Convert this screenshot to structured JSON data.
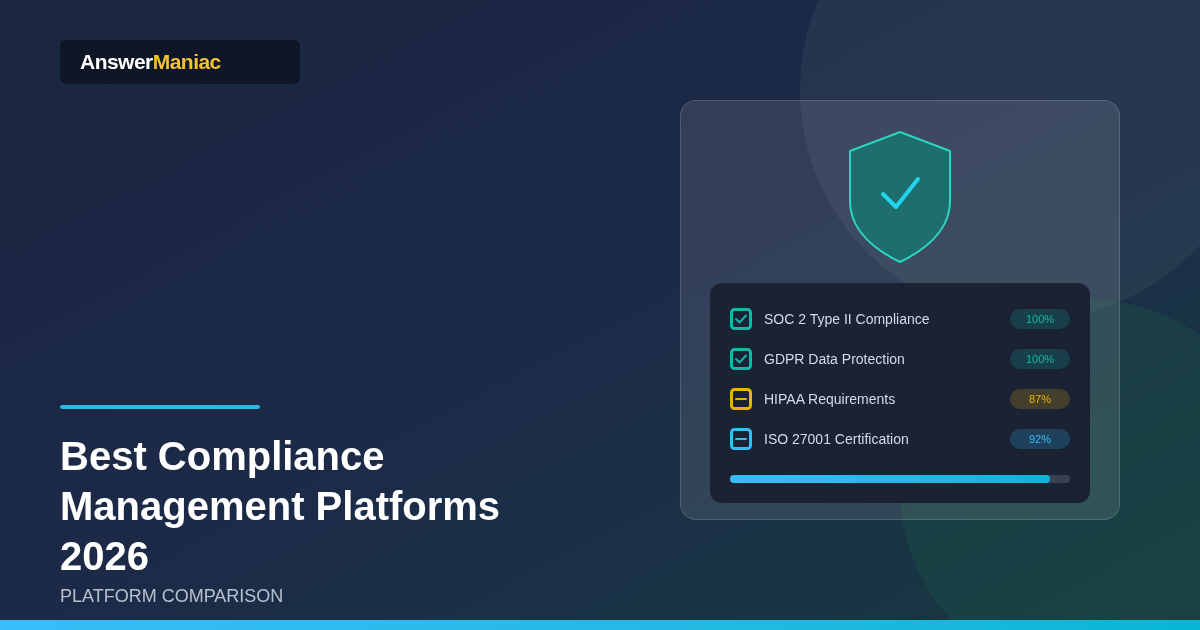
{
  "logo": {
    "first": "Answer",
    "second": "Maniac"
  },
  "title": "Best Compliance Management Platforms 2026",
  "subtitle": "PLATFORM COMPARISON",
  "checklist": {
    "items": [
      {
        "label": "SOC 2 Type II Compliance",
        "kind": "checked",
        "color": "#14b8a6",
        "value": "100%"
      },
      {
        "label": "GDPR Data Protection",
        "kind": "checked",
        "color": "#14b8a6",
        "value": "100%"
      },
      {
        "label": "HIPAA Requirements",
        "kind": "partial",
        "color": "#eab308",
        "value": "87%"
      },
      {
        "label": "ISO 27001 Certification",
        "kind": "partial",
        "color": "#38bdf8",
        "value": "92%"
      }
    ],
    "progress": {
      "level": 0.94
    }
  }
}
